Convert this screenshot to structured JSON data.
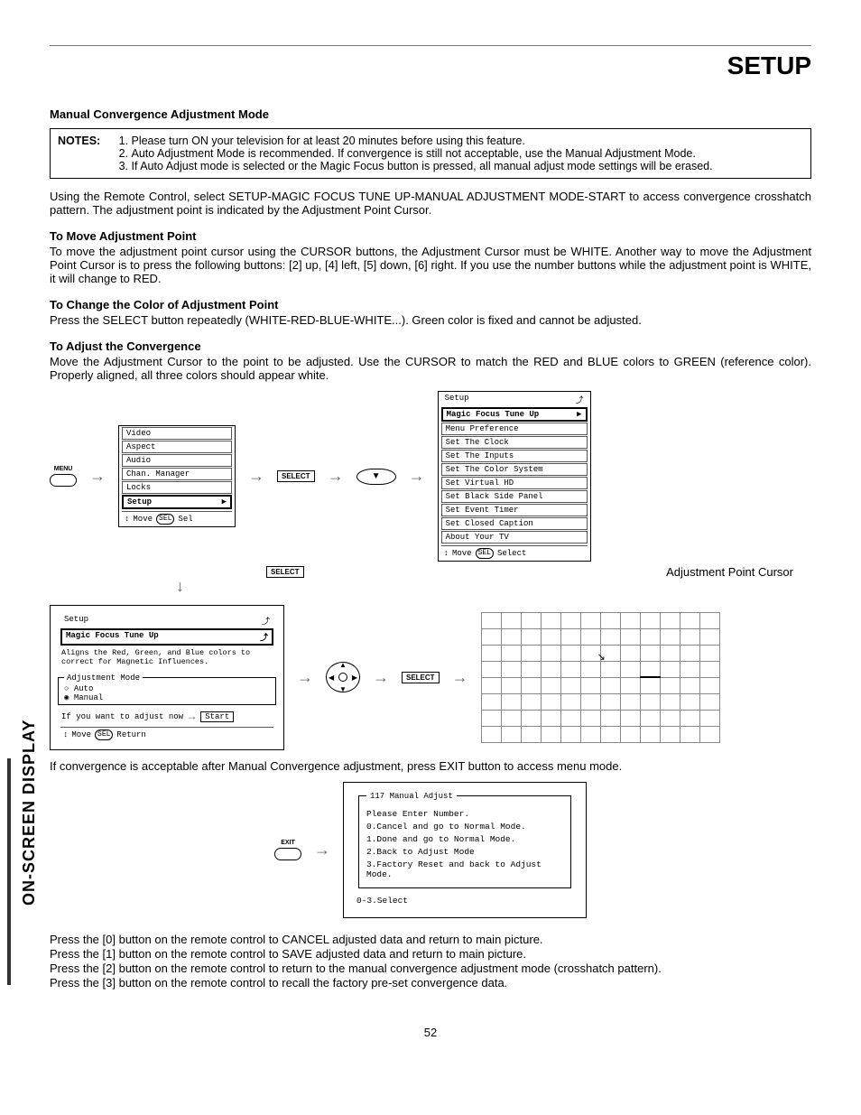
{
  "header": {
    "title": "SETUP",
    "page_number": "52"
  },
  "sidebar": {
    "label": "ON-SCREEN DISPLAY"
  },
  "section_title": "Manual Convergence Adjustment Mode",
  "notes": {
    "label": "NOTES:",
    "items": [
      "Please turn ON your television for at least 20 minutes before using this feature.",
      "Auto Adjustment Mode is recommended.  If convergence is still not acceptable, use the Manual Adjustment Mode.",
      "If Auto Adjust mode is selected or the Magic Focus button is pressed, all manual adjust mode settings will be erased."
    ]
  },
  "intro_para": "Using the Remote Control, select SETUP-MAGIC FOCUS TUNE UP-MANUAL ADJUSTMENT MODE-START to access convergence crosshatch pattern.  The adjustment point is indicated by the Adjustment Point Cursor.",
  "move_point": {
    "heading": "To Move Adjustment Point",
    "body": "To move the adjustment point cursor using the CURSOR buttons, the Adjustment Cursor must be WHITE.  Another way to move the Adjustment Point Cursor is to press the following buttons:  [2] up, [4] left, [5] down, [6] right.  If you use the number buttons while the adjustment point is WHITE, it will change to RED."
  },
  "change_color": {
    "heading": "To Change the Color of Adjustment Point",
    "body": "Press the SELECT button repeatedly (WHITE-RED-BLUE-WHITE...).  Green color is fixed and cannot be adjusted."
  },
  "adjust_conv": {
    "heading": "To Adjust the Convergence",
    "body": "Move the Adjustment Cursor to the point to be adjusted.  Use the CURSOR to match the RED and BLUE colors to GREEN (reference color).  Properly aligned, all three colors should appear white."
  },
  "after_adjust_line": "If convergence is acceptable after Manual Convergence adjustment, press EXIT button to access menu mode.",
  "press_lines": [
    "Press the [0] button on the remote control to CANCEL adjusted data and return to main picture.",
    "Press the [1] button on the remote control to SAVE adjusted data and return to main picture.",
    "Press the [2] button on the remote control to return to the manual convergence adjustment mode (crosshatch pattern).",
    "Press the [3] button on the remote control to recall the factory pre-set convergence data."
  ],
  "menu1": {
    "remote_label": "MENU",
    "items": [
      "Video",
      "Aspect",
      "Audio",
      "Chan. Manager",
      "Locks",
      "Setup"
    ],
    "selected_index": 5,
    "footer_left": "Move",
    "footer_btn": "SEL",
    "footer_right": "Sel"
  },
  "select_label": "SELECT",
  "menu2": {
    "title_item": "Setup",
    "items": [
      "Magic Focus Tune Up",
      "Menu Preference",
      "Set The Clock",
      "Set The Inputs",
      "Set The Color System",
      "Set Virtual HD",
      "Set Black Side Panel",
      "Set Event Timer",
      "Set Closed Caption",
      "About Your TV"
    ],
    "selected_index": 0,
    "footer_left": "Move",
    "footer_btn": "SEL",
    "footer_right": "Select"
  },
  "menu3": {
    "title_item": "Setup",
    "sub_item": "Magic Focus Tune Up",
    "desc": "Aligns the Red, Green, and Blue colors to correct for Magnetic Influences.",
    "fieldset_label": "Adjustment Mode",
    "opt_auto": "Auto",
    "opt_manual": "Manual",
    "prompt": "If you want to adjust now",
    "start": "Start",
    "footer_left": "Move",
    "footer_btn": "SEL",
    "footer_right": "Return"
  },
  "adj_cursor_label": "Adjustment Point Cursor",
  "exitmenu": {
    "remote_label": "EXIT",
    "fieldset_label": "117 Manual Adjust",
    "lines": [
      "Please Enter Number.",
      "0.Cancel and go to Normal Mode.",
      "1.Done and go to Normal Mode.",
      "2.Back to Adjust Mode",
      "3.Factory Reset and back to Adjust Mode."
    ],
    "footer": "0-3.Select"
  }
}
